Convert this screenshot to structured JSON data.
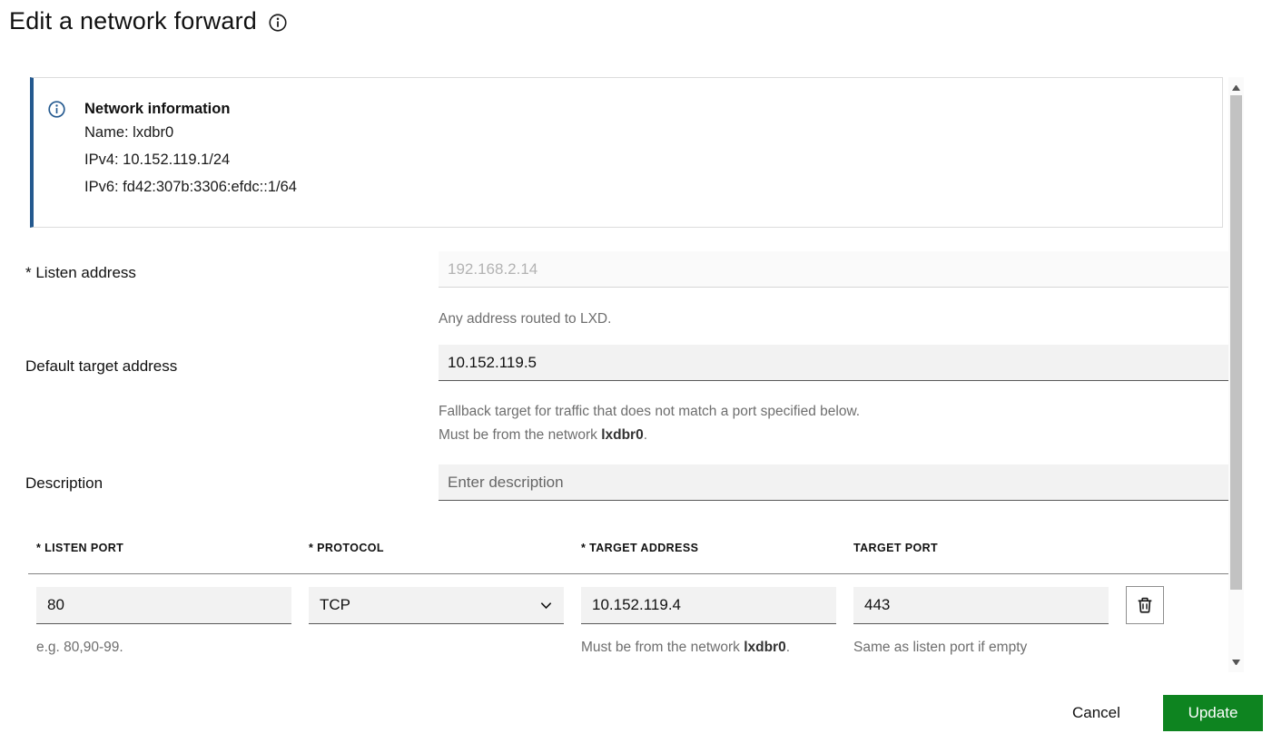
{
  "header": {
    "title": "Edit a network forward"
  },
  "notification": {
    "title": "Network information",
    "name_line": "Name: lxdbr0",
    "ipv4_line": "IPv4: 10.152.119.1/24",
    "ipv6_line": "IPv6: fd42:307b:3306:efdc::1/64"
  },
  "network": {
    "name": "lxdbr0"
  },
  "form": {
    "listen_address": {
      "label": "* Listen address",
      "value": "192.168.2.14",
      "help": "Any address routed to LXD."
    },
    "default_target_address": {
      "label": "Default target address",
      "value": "10.152.119.5",
      "help_line1": "Fallback target for traffic that does not match a port specified below.",
      "help_line2_prefix": "Must be from the network ",
      "help_line2_suffix": "."
    },
    "description": {
      "label": "Description",
      "placeholder": "Enter description"
    }
  },
  "ports_table": {
    "headers": {
      "listen_port": "* LISTEN PORT",
      "protocol": "* PROTOCOL",
      "target_address": "* TARGET ADDRESS",
      "target_port": "TARGET PORT"
    },
    "row": {
      "listen_port": "80",
      "protocol": "TCP",
      "target_address": "10.152.119.4",
      "target_port": "443"
    },
    "help": {
      "listen_port": "e.g. 80,90-99.",
      "target_address_prefix": "Must be from the network ",
      "target_address_suffix": ".",
      "target_port": "Same as listen port if empty"
    }
  },
  "footer": {
    "cancel_label": "Cancel",
    "update_label": "Update"
  },
  "colors": {
    "info_blue": "#24598f",
    "positive_green": "#0e8420"
  }
}
